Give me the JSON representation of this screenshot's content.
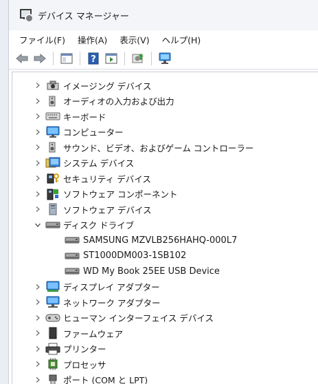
{
  "window": {
    "title": "デバイス マネージャー"
  },
  "menu": [
    "ファイル(F)",
    "操作(A)",
    "表示(V)",
    "ヘルプ(H)"
  ],
  "toolbar": [
    "back-arrow-icon",
    "forward-arrow-icon",
    "show-hide-console-tree-icon",
    "help-icon",
    "action-pane-icon",
    "update-driver-icon",
    "scan-hardware-icon"
  ],
  "tree": {
    "categories": [
      {
        "label": "イメージング デバイス",
        "icon": "camera-icon",
        "expanded": false
      },
      {
        "label": "オーディオの入力および出力",
        "icon": "speaker-icon",
        "expanded": false
      },
      {
        "label": "キーボード",
        "icon": "keyboard-icon",
        "expanded": false
      },
      {
        "label": "コンピューター",
        "icon": "computer-icon",
        "expanded": false
      },
      {
        "label": "サウンド、ビデオ、およびゲーム コントローラー",
        "icon": "sound-video-game-icon",
        "expanded": false
      },
      {
        "label": "システム デバイス",
        "icon": "system-devices-icon",
        "expanded": false
      },
      {
        "label": "セキュリティ デバイス",
        "icon": "security-key-icon",
        "expanded": false
      },
      {
        "label": "ソフトウェア コンポーネント",
        "icon": "software-component-icon",
        "expanded": false
      },
      {
        "label": "ソフトウェア デバイス",
        "icon": "software-device-icon",
        "expanded": false
      },
      {
        "label": "ディスク ドライブ",
        "icon": "disk-drive-icon",
        "expanded": true,
        "children": [
          {
            "label": "SAMSUNG MZVLB256HAHQ-000L7",
            "icon": "disk-drive-icon"
          },
          {
            "label": "ST1000DM003-1SB102",
            "icon": "disk-drive-icon"
          },
          {
            "label": "WD My Book 25EE USB Device",
            "icon": "disk-drive-icon"
          }
        ]
      },
      {
        "label": "ディスプレイ アダプター",
        "icon": "display-adapter-icon",
        "expanded": false
      },
      {
        "label": "ネットワーク アダプター",
        "icon": "network-adapter-icon",
        "expanded": false
      },
      {
        "label": "ヒューマン インターフェイス デバイス",
        "icon": "hid-icon",
        "expanded": false
      },
      {
        "label": "ファームウェア",
        "icon": "firmware-icon",
        "expanded": false
      },
      {
        "label": "プリンター",
        "icon": "printer-icon",
        "expanded": false
      },
      {
        "label": "プロセッサ",
        "icon": "processor-icon",
        "expanded": false
      },
      {
        "label": "ポート (COM と LPT)",
        "icon": "port-icon",
        "expanded": false
      }
    ]
  }
}
